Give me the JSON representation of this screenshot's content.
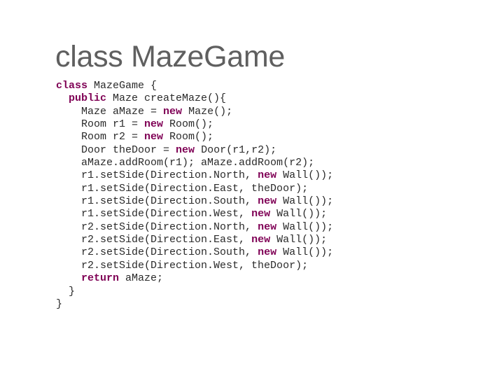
{
  "slide": {
    "title": "class MazeGame"
  },
  "code": {
    "language": "java",
    "keyword_color": "#7f0055",
    "keywords": [
      "class",
      "public",
      "new",
      "return"
    ],
    "lines": [
      {
        "indent": 0,
        "tokens": [
          {
            "t": "class",
            "kw": true
          },
          {
            "t": " MazeGame {"
          }
        ]
      },
      {
        "indent": 2,
        "tokens": [
          {
            "t": "public",
            "kw": true
          },
          {
            "t": " Maze createMaze(){"
          }
        ]
      },
      {
        "indent": 4,
        "tokens": [
          {
            "t": "Maze aMaze = "
          },
          {
            "t": "new",
            "kw": true
          },
          {
            "t": " Maze();"
          }
        ]
      },
      {
        "indent": 4,
        "tokens": [
          {
            "t": "Room r1 = "
          },
          {
            "t": "new",
            "kw": true
          },
          {
            "t": " Room();"
          }
        ]
      },
      {
        "indent": 4,
        "tokens": [
          {
            "t": "Room r2 = "
          },
          {
            "t": "new",
            "kw": true
          },
          {
            "t": " Room();"
          }
        ]
      },
      {
        "indent": 4,
        "tokens": [
          {
            "t": "Door theDoor = "
          },
          {
            "t": "new",
            "kw": true
          },
          {
            "t": " Door(r1,r2);"
          }
        ]
      },
      {
        "indent": 4,
        "tokens": [
          {
            "t": "aMaze.addRoom(r1); aMaze.addRoom(r2);"
          }
        ]
      },
      {
        "indent": 4,
        "tokens": [
          {
            "t": "r1.setSide(Direction.North, "
          },
          {
            "t": "new",
            "kw": true
          },
          {
            "t": " Wall());"
          }
        ]
      },
      {
        "indent": 4,
        "tokens": [
          {
            "t": "r1.setSide(Direction.East, theDoor);"
          }
        ]
      },
      {
        "indent": 4,
        "tokens": [
          {
            "t": "r1.setSide(Direction.South, "
          },
          {
            "t": "new",
            "kw": true
          },
          {
            "t": " Wall());"
          }
        ]
      },
      {
        "indent": 4,
        "tokens": [
          {
            "t": "r1.setSide(Direction.West, "
          },
          {
            "t": "new",
            "kw": true
          },
          {
            "t": " Wall());"
          }
        ]
      },
      {
        "indent": 4,
        "tokens": [
          {
            "t": "r2.setSide(Direction.North, "
          },
          {
            "t": "new",
            "kw": true
          },
          {
            "t": " Wall());"
          }
        ]
      },
      {
        "indent": 4,
        "tokens": [
          {
            "t": "r2.setSide(Direction.East, "
          },
          {
            "t": "new",
            "kw": true
          },
          {
            "t": " Wall());"
          }
        ]
      },
      {
        "indent": 4,
        "tokens": [
          {
            "t": "r2.setSide(Direction.South, "
          },
          {
            "t": "new",
            "kw": true
          },
          {
            "t": " Wall());"
          }
        ]
      },
      {
        "indent": 4,
        "tokens": [
          {
            "t": "r2.setSide(Direction.West, theDoor);"
          }
        ]
      },
      {
        "indent": 4,
        "tokens": [
          {
            "t": "return",
            "kw": true
          },
          {
            "t": " aMaze;"
          }
        ]
      },
      {
        "indent": 2,
        "tokens": [
          {
            "t": "}"
          }
        ]
      },
      {
        "indent": 0,
        "tokens": [
          {
            "t": "}"
          }
        ]
      }
    ]
  }
}
